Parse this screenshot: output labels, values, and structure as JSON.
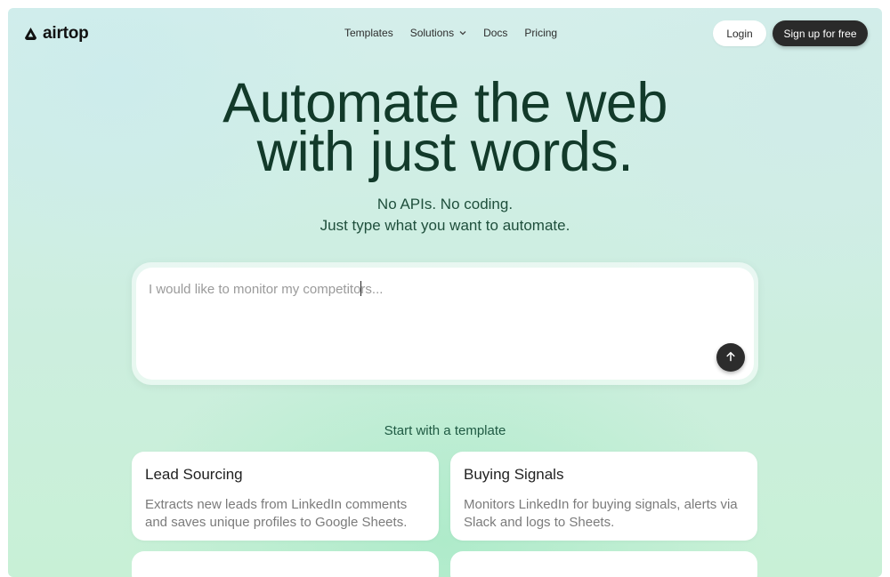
{
  "nav": {
    "logo_text": "airtop",
    "links": [
      {
        "label": "Templates"
      },
      {
        "label": "Solutions",
        "has_dropdown": true
      },
      {
        "label": "Docs"
      },
      {
        "label": "Pricing"
      }
    ],
    "login_label": "Login",
    "signup_label": "Sign up for free"
  },
  "hero": {
    "title_line1": "Automate the web",
    "title_line2": "with just words.",
    "subtitle_line1": "No APIs. No coding.",
    "subtitle_line2": "Just type what you want to automate."
  },
  "prompt": {
    "placeholder": "I would like to monitor my competitors..."
  },
  "templates": {
    "heading": "Start with a template",
    "cards": [
      {
        "title": "Lead Sourcing",
        "description": "Extracts new leads from LinkedIn comments and saves unique profiles to Google Sheets."
      },
      {
        "title": "Buying Signals",
        "description": "Monitors LinkedIn for buying signals, alerts via Slack and logs to Sheets."
      }
    ]
  },
  "colors": {
    "heading_green": "#123a2a",
    "subtitle_green": "#1f4f3c",
    "dark_button": "#2a2a2a"
  }
}
